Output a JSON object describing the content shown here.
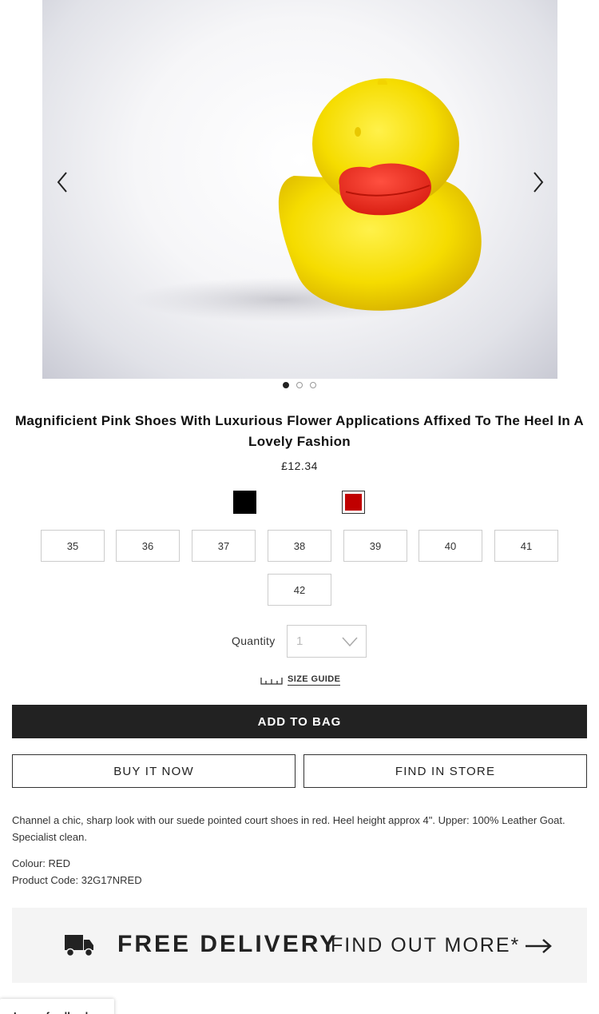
{
  "gallery": {
    "image_subject": "yellow rubber duck",
    "slide_count": 3,
    "active_slide": 1
  },
  "product": {
    "title": "Magnificient Pink Shoes With Luxurious Flower Applications Affixed To The Heel In A Lovely Fashion",
    "price": "£12.34",
    "colors": [
      {
        "name": "black",
        "hex": "#000000"
      },
      {
        "name": "red",
        "hex": "#c00000",
        "selected": true
      }
    ],
    "sizes": [
      "35",
      "36",
      "37",
      "38",
      "39",
      "40",
      "41",
      "42"
    ],
    "description": "Channel a chic, sharp look with our suede pointed court shoes in red. Heel height approx 4\". Upper: 100% Leather Goat. Specialist clean.",
    "colour_line": "Colour: RED",
    "code_line": "Product Code: 32G17NRED"
  },
  "quantity": {
    "label": "Quantity",
    "value": "1"
  },
  "size_guide": {
    "label": "SIZE GUIDE"
  },
  "actions": {
    "add_to_bag": "ADD TO BAG",
    "buy_now": "BUY IT NOW",
    "find_in_store": "FIND IN STORE"
  },
  "delivery": {
    "headline": "FREE DELIVERY",
    "link": "FIND OUT MORE*"
  },
  "feedback": {
    "label": "Leave feedback"
  }
}
